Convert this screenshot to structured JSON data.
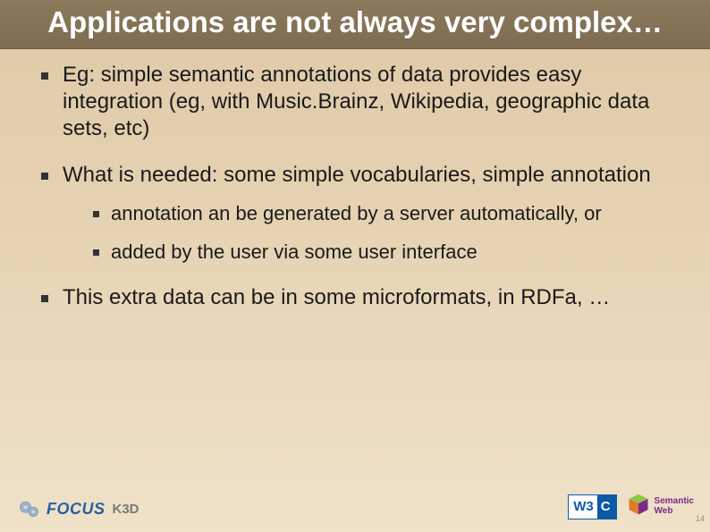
{
  "title": "Applications are not always very complex…",
  "bullets": {
    "b1": "Eg: simple semantic annotations of data provides easy integration (eg, with Music.Brainz, Wikipedia, geographic data sets, etc)",
    "b2": "What is needed: some simple vocabularies, simple annotation",
    "b2_sub": {
      "s1": "annotation an be generated by a server automatically, or",
      "s2": "added by the user via some user interface"
    },
    "b3": "This extra data can be in some microformats, in RDFa, …"
  },
  "footer": {
    "focus": "FOCUS",
    "k3d": "K3D",
    "w3c_left": "W3",
    "w3c_right": "C",
    "semweb_line1": "Semantic",
    "semweb_line2": "Web",
    "page_num": "14"
  }
}
